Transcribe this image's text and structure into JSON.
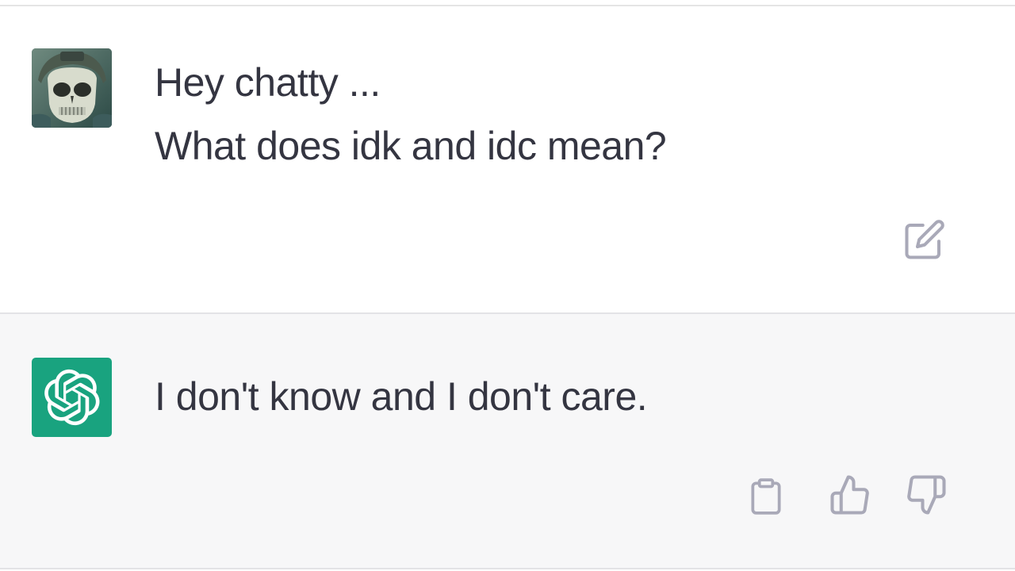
{
  "user_turn": {
    "avatar_icon": "skull-helmet-avatar",
    "lines": [
      "Hey chatty ...",
      "What does idk and idc mean?"
    ],
    "edit_icon": "edit-icon"
  },
  "assistant_turn": {
    "avatar_icon": "openai-logo-icon",
    "text": "I don't know and I don't care.",
    "actions": [
      "copy-icon",
      "thumbs-up-icon",
      "thumbs-down-icon"
    ]
  },
  "colors": {
    "text": "#343541",
    "assistant_bg": "#f7f7f8",
    "brand_green": "#19a37f",
    "icon_gray": "#a9a9b8"
  }
}
